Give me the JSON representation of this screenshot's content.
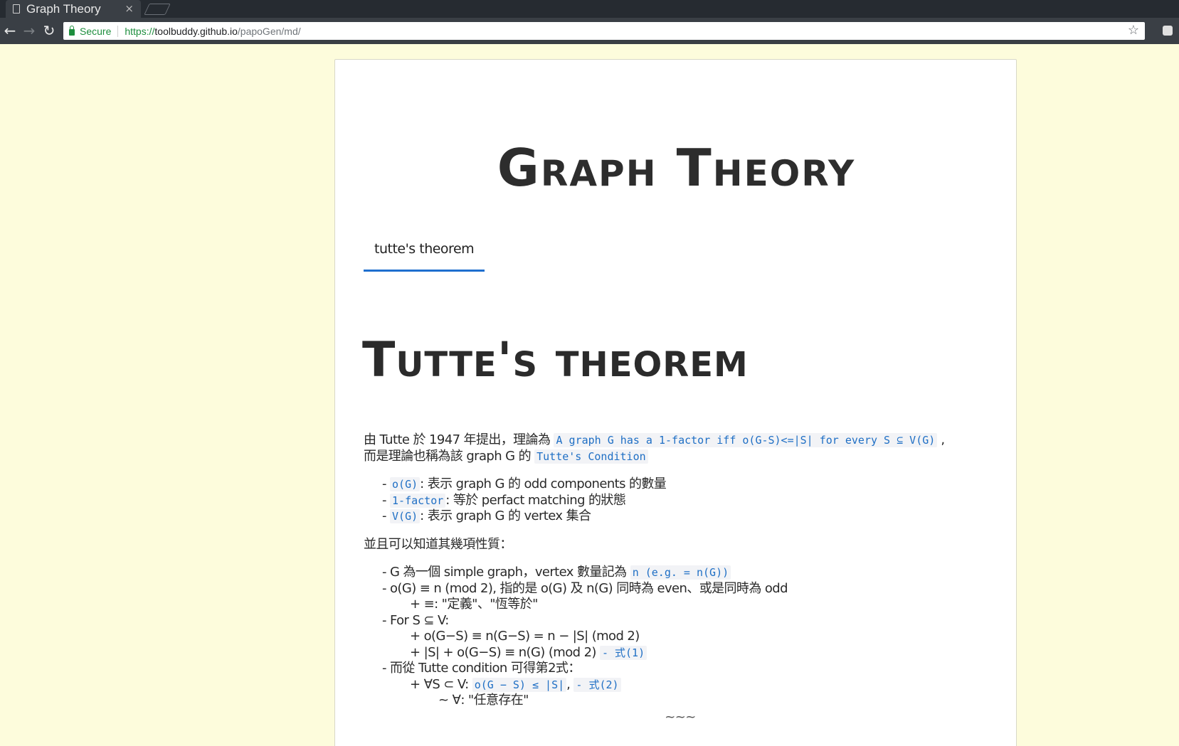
{
  "browser": {
    "tab_title": "Graph Theory",
    "tab_close": "×",
    "secure_label": "Secure",
    "url_scheme": "https://",
    "url_host": "toolbuddy.github.io",
    "url_path": "/papoGen/md/"
  },
  "page": {
    "site_title": "Graph Theory",
    "tabs": [
      {
        "label": "tutte's theorem"
      }
    ],
    "post_title": "Tutte's theorem",
    "intro": {
      "l1_text": "由 Tutte 於 1947 年提出，理論為 ",
      "l1_code": "A graph G has a 1-factor iff o(G-S)<=|S| for every S ⊆ V(G)",
      "l1_tail": " ,",
      "l2_text": "而是理論也稱為該 graph G 的 ",
      "l2_code": "Tutte's Condition"
    },
    "defs": [
      {
        "prefix": "- ",
        "code": "o(G)",
        "text": ": 表示 graph G 的 odd components 的數量"
      },
      {
        "prefix": "- ",
        "code": "1-factor",
        "text": ": 等於 perfact matching 的狀態"
      },
      {
        "prefix": "- ",
        "code": "V(G)",
        "text": ": 表示 graph G 的 vertex 集合"
      }
    ],
    "properties_heading": "並且可以知道其幾項性質：",
    "properties": {
      "p1_text": "- G 為一個 simple graph，vertex 數量記為 ",
      "p1_code": "n (e.g. = n(G))",
      "p2": "- o(G) ≡ n (mod 2), 指的是 o(G) 及 n(G) 同時為 even、或是同時為 odd",
      "p2a": "+ ≡: \"定義\"、\"恆等於\"",
      "p3": "- For S ⊆ V:",
      "p3a": "+ o(G−S) ≡ n(G−S) = n − |S| (mod 2)",
      "p3b_text": "+ |S| + o(G−S) ≡ n(G) (mod 2) ",
      "p3b_code": "- 式(1)",
      "p4": "- 而從 Tutte condition 可得第2式：",
      "p4a_text": "+ ∀S ⊂ V: ",
      "p4a_code1": "o(G − S) ≤ |S|",
      "p4a_sep": ", ",
      "p4a_code2": "- 式(2)",
      "p4b": "~ ∀: \"任意存在\""
    },
    "separator": "~~~"
  }
}
